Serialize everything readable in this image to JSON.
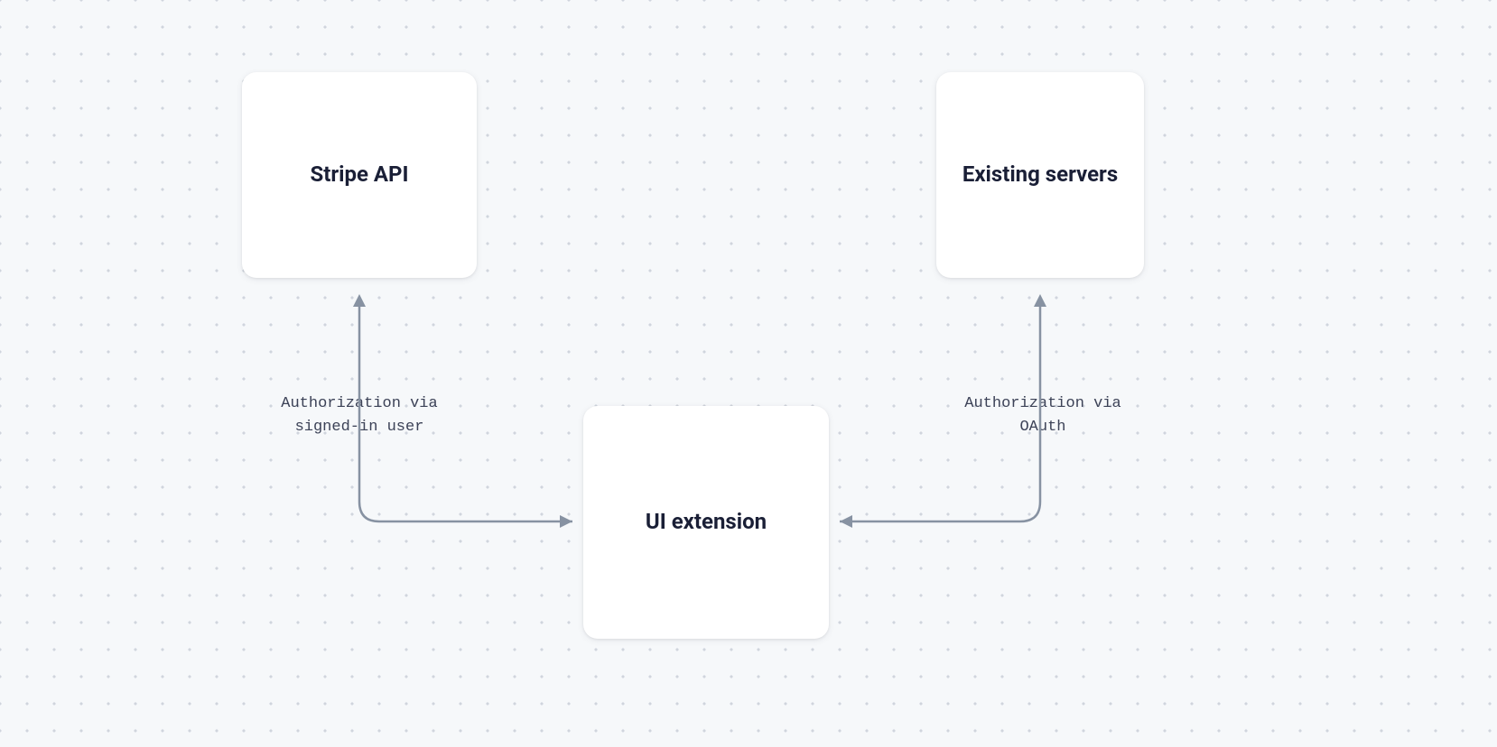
{
  "nodes": {
    "stripe_api": {
      "label": "Stripe API"
    },
    "existing_servers": {
      "label": "Existing\nservers"
    },
    "ui_extension": {
      "label": "UI extension"
    }
  },
  "edges": {
    "left": {
      "label": "Authorization via\nsigned-in user"
    },
    "right": {
      "label": "Authorization via\nOAuth"
    }
  }
}
